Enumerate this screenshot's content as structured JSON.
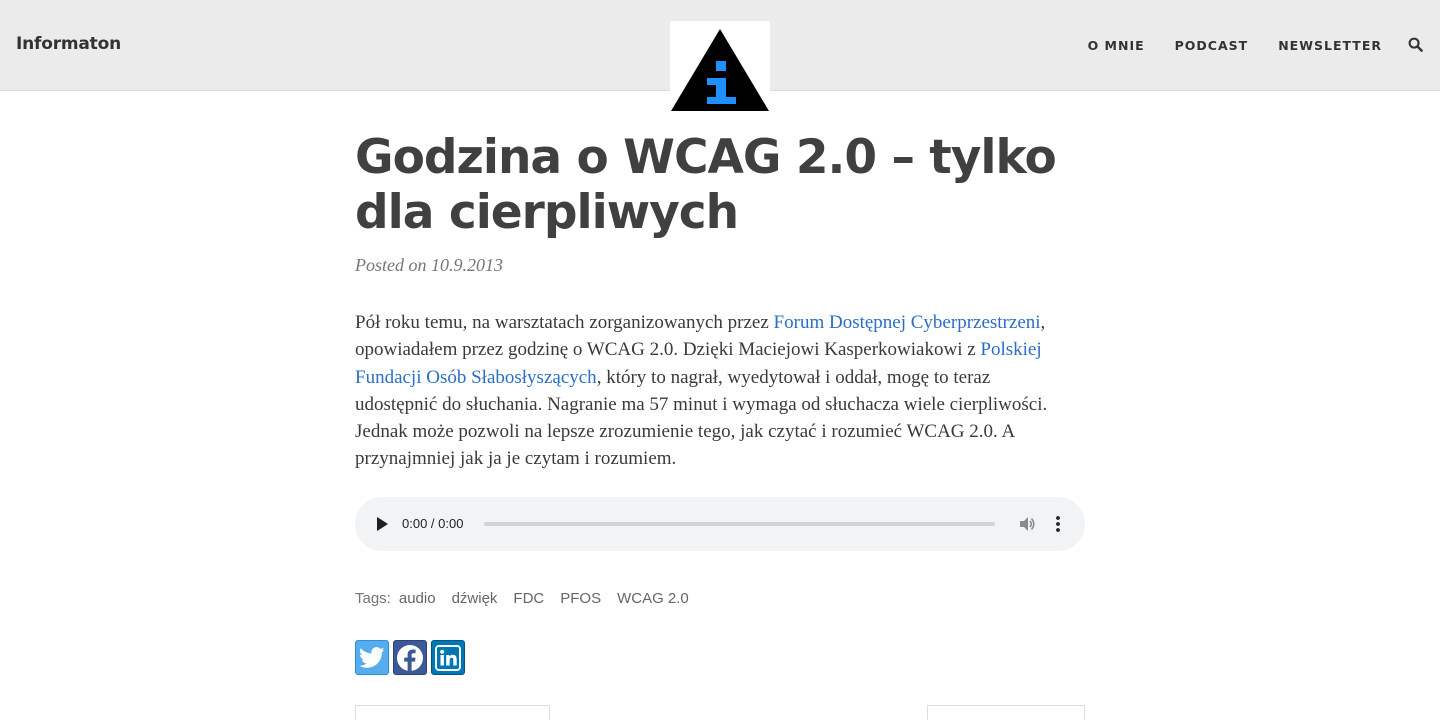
{
  "site": {
    "title": "Informaton",
    "logo_icon": "info-triangle-icon",
    "colors": {
      "header_bg": "#ebebeb",
      "link": "#2a6ec7",
      "logo_blue": "#1e90ff"
    }
  },
  "nav": {
    "items": [
      {
        "label": "O MNIE"
      },
      {
        "label": "PODCAST"
      },
      {
        "label": "NEWSLETTER"
      }
    ],
    "search_icon": "search-icon"
  },
  "post": {
    "title": "Godzina o WCAG 2.0 – tylko dla cierpliwych",
    "posted_prefix": "Posted on",
    "date": "10.9.2013",
    "body": {
      "t1": "Pół roku temu, na warsztatach zorganizowanych przez ",
      "link1": "Forum Dostępnej Cyberprzestrzeni",
      "t2": ", opowiadałem przez godzinę o WCAG 2.0. Dzięki Maciejowi Kasperkowiakowi z ",
      "link2": "Polskiej Fundacji Osób Słabosłyszących",
      "t3": ", który to nagrał, wyedytował i oddał, mogę to teraz udostępnić do słuchania. Nagranie ma 57 minut i wymaga od słuchacza wiele cierpliwości. Jednak może pozwoli na lepsze zrozumienie tego, jak czytać i rozumieć WCAG 2.0. A przynajmniej jak ja je czytam i rozumiem."
    }
  },
  "audio": {
    "time": "0:00 / 0:00",
    "progress": 0
  },
  "tags": {
    "label": "Tags:",
    "items": [
      "audio",
      "dźwięk",
      "FDC",
      "PFOS",
      "WCAG 2.0"
    ]
  },
  "share": {
    "items": [
      "twitter-icon",
      "facebook-icon",
      "linkedin-icon"
    ]
  }
}
